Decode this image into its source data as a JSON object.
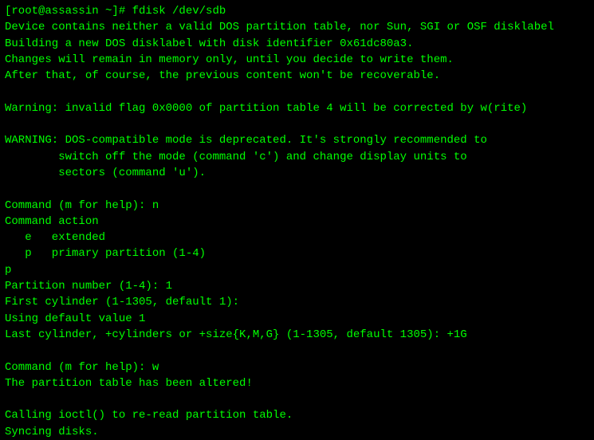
{
  "terminal": {
    "lines": [
      "[root@assassin ~]# fdisk /dev/sdb",
      "Device contains neither a valid DOS partition table, nor Sun, SGI or OSF disklabel",
      "Building a new DOS disklabel with disk identifier 0x61dc80a3.",
      "Changes will remain in memory only, until you decide to write them.",
      "After that, of course, the previous content won't be recoverable.",
      "",
      "Warning: invalid flag 0x0000 of partition table 4 will be corrected by w(rite)",
      "",
      "WARNING: DOS-compatible mode is deprecated. It's strongly recommended to",
      "        switch off the mode (command 'c') and change display units to",
      "        sectors (command 'u').",
      "",
      "Command (m for help): n",
      "Command action",
      "   e   extended",
      "   p   primary partition (1-4)",
      "p",
      "Partition number (1-4): 1",
      "First cylinder (1-1305, default 1):",
      "Using default value 1",
      "Last cylinder, +cylinders or +size{K,M,G} (1-1305, default 1305): +1G",
      "",
      "Command (m for help): w",
      "The partition table has been altered!",
      "",
      "Calling ioctl() to re-read partition table.",
      "Syncing disks."
    ]
  }
}
